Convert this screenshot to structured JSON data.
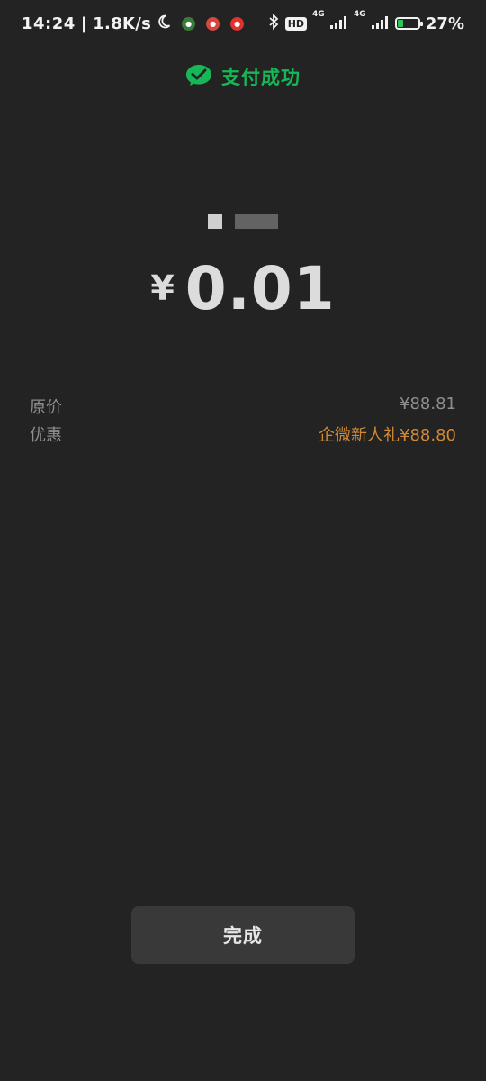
{
  "status_bar": {
    "time": "14:24",
    "network_speed": "| 1.8K/s",
    "hd_label": "HD",
    "net1_label": "4G",
    "net2_label": "4G",
    "battery_percent": "27%",
    "battery_level": 0.27,
    "battery_color": "#2bc65a"
  },
  "header": {
    "title": "支付成功",
    "accent_color": "#15b756"
  },
  "payment": {
    "currency_symbol": "¥",
    "amount": "0.01"
  },
  "details": {
    "original_price_label": "原价",
    "original_price_value": "¥88.81",
    "discount_label": "优惠",
    "discount_value": "企微新人礼¥88.80",
    "discount_color": "#d08a36"
  },
  "actions": {
    "done_label": "完成"
  }
}
